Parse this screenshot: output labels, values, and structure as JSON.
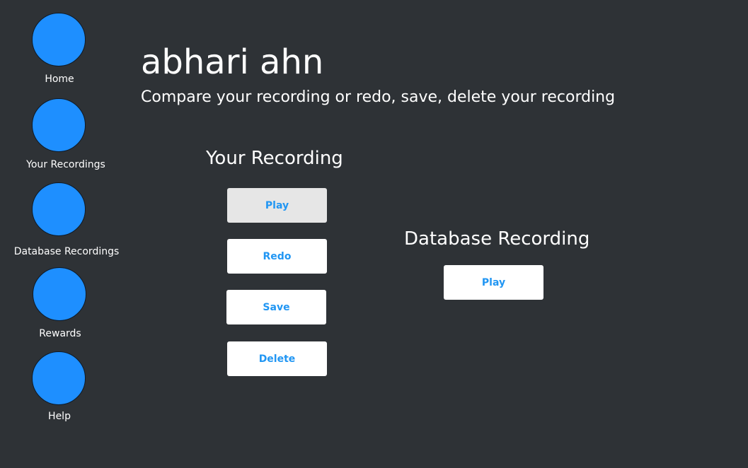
{
  "sidebar": {
    "items": [
      {
        "label": "Home"
      },
      {
        "label": "Your Recordings"
      },
      {
        "label": "Database Recordings"
      },
      {
        "label": "Rewards"
      },
      {
        "label": "Help"
      }
    ]
  },
  "header": {
    "title": "abhari ahn",
    "subtitle": "Compare your recording or redo, save, delete your recording"
  },
  "your_recording": {
    "heading": "Your Recording",
    "play_label": "Play",
    "redo_label": "Redo",
    "save_label": "Save",
    "delete_label": "Delete"
  },
  "database_recording": {
    "heading": "Database Recording",
    "play_label": "Play"
  },
  "colors": {
    "background": "#2e3236",
    "nav_circle": "#1e8fff",
    "button_text": "#2196f3",
    "button_bg": "#ffffff",
    "button_active_bg": "#e6e6e6"
  }
}
